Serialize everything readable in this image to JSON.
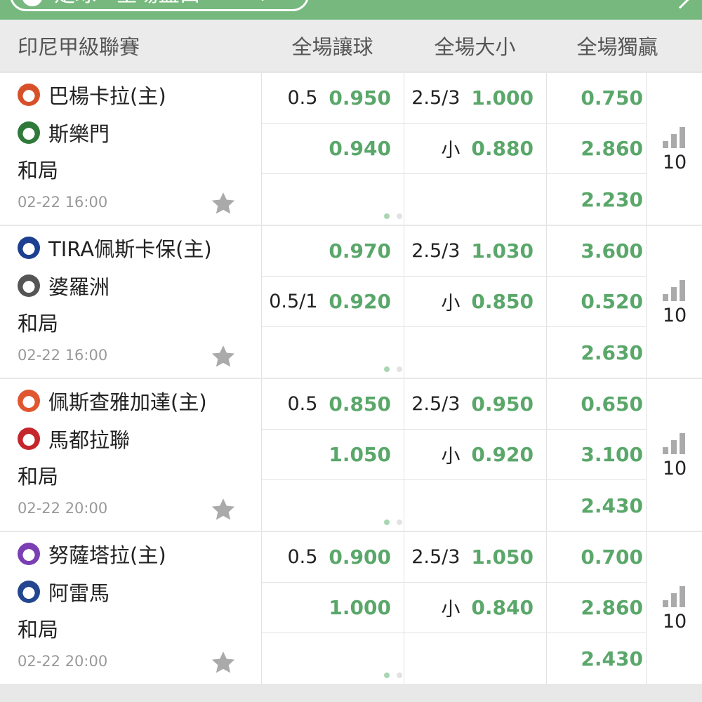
{
  "top": {
    "filter_label": "足球 · 全場盤口"
  },
  "header": {
    "league": "印尼甲級聯賽",
    "col_handicap": "全場讓球",
    "col_total": "全場大小",
    "col_1x2": "全場獨贏"
  },
  "colors": {
    "brand": "#76b87e",
    "odds": "#5aa76a"
  },
  "matches": [
    {
      "home": "巴楊卡拉(主)",
      "away": "斯樂門",
      "draw": "和局",
      "time": "02-22 16:00",
      "hdp": {
        "home_line": "0.5",
        "home_odds": "0.950",
        "away_line": "",
        "away_odds": "0.940"
      },
      "ou": {
        "over_line": "2.5/3",
        "over_odds": "1.000",
        "under_label": "小",
        "under_odds": "0.880"
      },
      "x12": {
        "home": "0.750",
        "away": "2.860",
        "draw": "2.230"
      },
      "more_count": "10",
      "logos": {
        "home": "#d8502a",
        "away": "#2f7a3a"
      }
    },
    {
      "home": "TIRA佩斯卡保(主)",
      "away": "婆羅洲",
      "draw": "和局",
      "time": "02-22 16:00",
      "hdp": {
        "home_line": "",
        "home_odds": "0.970",
        "away_line": "0.5/1",
        "away_odds": "0.920"
      },
      "ou": {
        "over_line": "2.5/3",
        "over_odds": "1.030",
        "under_label": "小",
        "under_odds": "0.850"
      },
      "x12": {
        "home": "3.600",
        "away": "0.520",
        "draw": "2.630"
      },
      "more_count": "10",
      "logos": {
        "home": "#1d3f8f",
        "away": "#555555"
      }
    },
    {
      "home": "佩斯查雅加達(主)",
      "away": "馬都拉聯",
      "draw": "和局",
      "time": "02-22 20:00",
      "hdp": {
        "home_line": "0.5",
        "home_odds": "0.850",
        "away_line": "",
        "away_odds": "1.050"
      },
      "ou": {
        "over_line": "2.5/3",
        "over_odds": "0.950",
        "under_label": "小",
        "under_odds": "0.920"
      },
      "x12": {
        "home": "0.650",
        "away": "3.100",
        "draw": "2.430"
      },
      "more_count": "10",
      "logos": {
        "home": "#e0562e",
        "away": "#c4262c"
      }
    },
    {
      "home": "努薩塔拉(主)",
      "away": "阿雷馬",
      "draw": "和局",
      "time": "02-22 20:00",
      "hdp": {
        "home_line": "0.5",
        "home_odds": "0.900",
        "away_line": "",
        "away_odds": "1.000"
      },
      "ou": {
        "over_line": "2.5/3",
        "over_odds": "1.050",
        "under_label": "小",
        "under_odds": "0.840"
      },
      "x12": {
        "home": "0.700",
        "away": "2.860",
        "draw": "2.430"
      },
      "more_count": "10",
      "logos": {
        "home": "#7b3fb3",
        "away": "#23468f"
      }
    }
  ]
}
